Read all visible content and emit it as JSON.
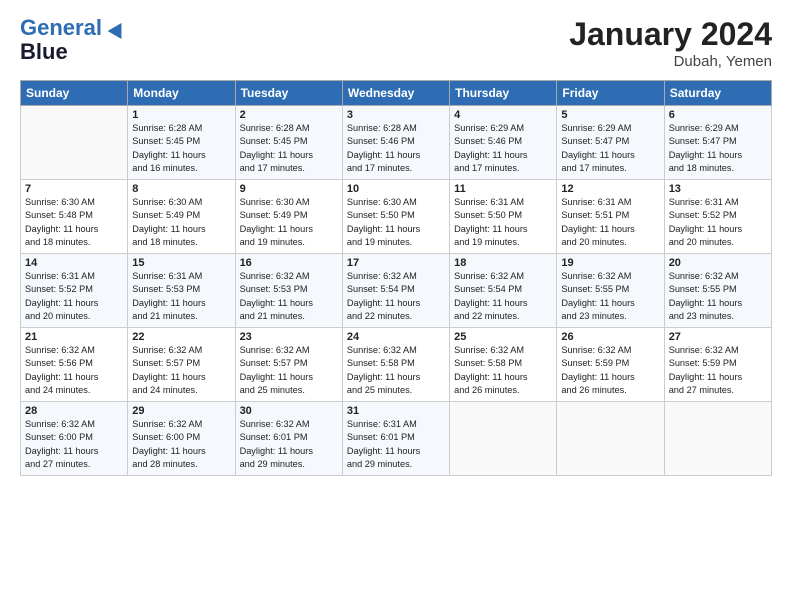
{
  "header": {
    "logo_line1": "General",
    "logo_line2": "Blue",
    "month_year": "January 2024",
    "location": "Dubah, Yemen"
  },
  "days_of_week": [
    "Sunday",
    "Monday",
    "Tuesday",
    "Wednesday",
    "Thursday",
    "Friday",
    "Saturday"
  ],
  "weeks": [
    [
      {
        "day": "",
        "info": ""
      },
      {
        "day": "1",
        "info": "Sunrise: 6:28 AM\nSunset: 5:45 PM\nDaylight: 11 hours\nand 16 minutes."
      },
      {
        "day": "2",
        "info": "Sunrise: 6:28 AM\nSunset: 5:45 PM\nDaylight: 11 hours\nand 17 minutes."
      },
      {
        "day": "3",
        "info": "Sunrise: 6:28 AM\nSunset: 5:46 PM\nDaylight: 11 hours\nand 17 minutes."
      },
      {
        "day": "4",
        "info": "Sunrise: 6:29 AM\nSunset: 5:46 PM\nDaylight: 11 hours\nand 17 minutes."
      },
      {
        "day": "5",
        "info": "Sunrise: 6:29 AM\nSunset: 5:47 PM\nDaylight: 11 hours\nand 17 minutes."
      },
      {
        "day": "6",
        "info": "Sunrise: 6:29 AM\nSunset: 5:47 PM\nDaylight: 11 hours\nand 18 minutes."
      }
    ],
    [
      {
        "day": "7",
        "info": "Sunrise: 6:30 AM\nSunset: 5:48 PM\nDaylight: 11 hours\nand 18 minutes."
      },
      {
        "day": "8",
        "info": "Sunrise: 6:30 AM\nSunset: 5:49 PM\nDaylight: 11 hours\nand 18 minutes."
      },
      {
        "day": "9",
        "info": "Sunrise: 6:30 AM\nSunset: 5:49 PM\nDaylight: 11 hours\nand 19 minutes."
      },
      {
        "day": "10",
        "info": "Sunrise: 6:30 AM\nSunset: 5:50 PM\nDaylight: 11 hours\nand 19 minutes."
      },
      {
        "day": "11",
        "info": "Sunrise: 6:31 AM\nSunset: 5:50 PM\nDaylight: 11 hours\nand 19 minutes."
      },
      {
        "day": "12",
        "info": "Sunrise: 6:31 AM\nSunset: 5:51 PM\nDaylight: 11 hours\nand 20 minutes."
      },
      {
        "day": "13",
        "info": "Sunrise: 6:31 AM\nSunset: 5:52 PM\nDaylight: 11 hours\nand 20 minutes."
      }
    ],
    [
      {
        "day": "14",
        "info": "Sunrise: 6:31 AM\nSunset: 5:52 PM\nDaylight: 11 hours\nand 20 minutes."
      },
      {
        "day": "15",
        "info": "Sunrise: 6:31 AM\nSunset: 5:53 PM\nDaylight: 11 hours\nand 21 minutes."
      },
      {
        "day": "16",
        "info": "Sunrise: 6:32 AM\nSunset: 5:53 PM\nDaylight: 11 hours\nand 21 minutes."
      },
      {
        "day": "17",
        "info": "Sunrise: 6:32 AM\nSunset: 5:54 PM\nDaylight: 11 hours\nand 22 minutes."
      },
      {
        "day": "18",
        "info": "Sunrise: 6:32 AM\nSunset: 5:54 PM\nDaylight: 11 hours\nand 22 minutes."
      },
      {
        "day": "19",
        "info": "Sunrise: 6:32 AM\nSunset: 5:55 PM\nDaylight: 11 hours\nand 23 minutes."
      },
      {
        "day": "20",
        "info": "Sunrise: 6:32 AM\nSunset: 5:55 PM\nDaylight: 11 hours\nand 23 minutes."
      }
    ],
    [
      {
        "day": "21",
        "info": "Sunrise: 6:32 AM\nSunset: 5:56 PM\nDaylight: 11 hours\nand 24 minutes."
      },
      {
        "day": "22",
        "info": "Sunrise: 6:32 AM\nSunset: 5:57 PM\nDaylight: 11 hours\nand 24 minutes."
      },
      {
        "day": "23",
        "info": "Sunrise: 6:32 AM\nSunset: 5:57 PM\nDaylight: 11 hours\nand 25 minutes."
      },
      {
        "day": "24",
        "info": "Sunrise: 6:32 AM\nSunset: 5:58 PM\nDaylight: 11 hours\nand 25 minutes."
      },
      {
        "day": "25",
        "info": "Sunrise: 6:32 AM\nSunset: 5:58 PM\nDaylight: 11 hours\nand 26 minutes."
      },
      {
        "day": "26",
        "info": "Sunrise: 6:32 AM\nSunset: 5:59 PM\nDaylight: 11 hours\nand 26 minutes."
      },
      {
        "day": "27",
        "info": "Sunrise: 6:32 AM\nSunset: 5:59 PM\nDaylight: 11 hours\nand 27 minutes."
      }
    ],
    [
      {
        "day": "28",
        "info": "Sunrise: 6:32 AM\nSunset: 6:00 PM\nDaylight: 11 hours\nand 27 minutes."
      },
      {
        "day": "29",
        "info": "Sunrise: 6:32 AM\nSunset: 6:00 PM\nDaylight: 11 hours\nand 28 minutes."
      },
      {
        "day": "30",
        "info": "Sunrise: 6:32 AM\nSunset: 6:01 PM\nDaylight: 11 hours\nand 29 minutes."
      },
      {
        "day": "31",
        "info": "Sunrise: 6:31 AM\nSunset: 6:01 PM\nDaylight: 11 hours\nand 29 minutes."
      },
      {
        "day": "",
        "info": ""
      },
      {
        "day": "",
        "info": ""
      },
      {
        "day": "",
        "info": ""
      }
    ]
  ]
}
